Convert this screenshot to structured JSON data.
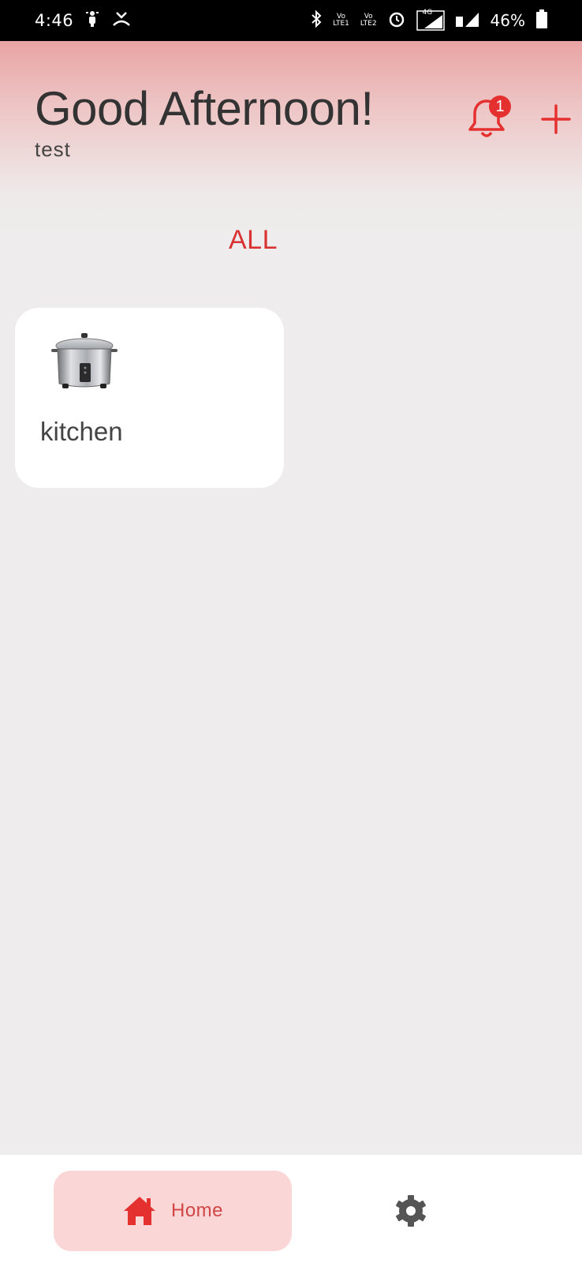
{
  "status_bar": {
    "time": "4:46",
    "vo_lte1": [
      "Vo",
      "LTE1"
    ],
    "vo_lte2": [
      "Vo",
      "LTE2"
    ],
    "network": "4G",
    "battery": "46%"
  },
  "header": {
    "greeting": "Good Afternoon!",
    "username": "test",
    "notification_count": "1"
  },
  "tabs": {
    "active": "ALL"
  },
  "rooms": [
    {
      "name": "kitchen",
      "icon": "rice-cooker-icon"
    }
  ],
  "bottom_nav": {
    "home_label": "Home",
    "settings_icon": "gear-icon"
  },
  "colors": {
    "accent": "#e53030",
    "header_gradient_top": "#e9a4a4",
    "background": "#eeecec",
    "nav_active_bg": "#fad6d6"
  }
}
